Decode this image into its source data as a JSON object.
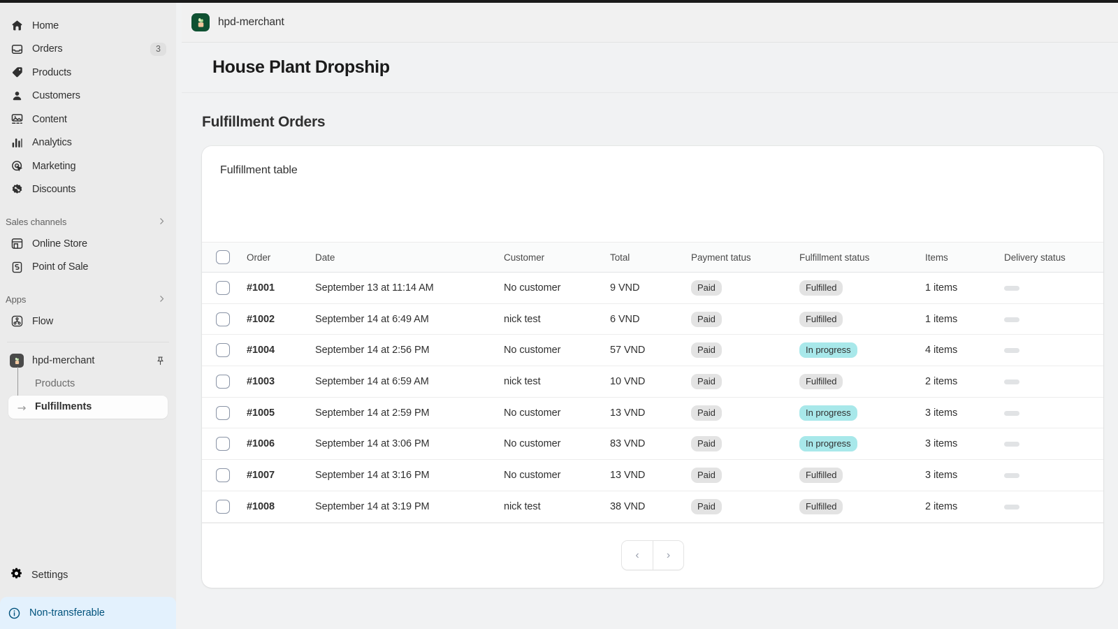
{
  "sidebar": {
    "nav": [
      {
        "label": "Home",
        "icon": "home-icon"
      },
      {
        "label": "Orders",
        "icon": "orders-icon",
        "count": "3"
      },
      {
        "label": "Products",
        "icon": "products-tag-icon"
      },
      {
        "label": "Customers",
        "icon": "customers-person-icon"
      },
      {
        "label": "Content",
        "icon": "content-image-icon"
      },
      {
        "label": "Analytics",
        "icon": "analytics-bars-icon"
      },
      {
        "label": "Marketing",
        "icon": "marketing-target-icon"
      },
      {
        "label": "Discounts",
        "icon": "discounts-badge-icon"
      }
    ],
    "sales_channels": {
      "label": "Sales channels",
      "chevron": "chevron-right-icon"
    },
    "channels": [
      {
        "label": "Online Store",
        "icon": "storefront-icon"
      },
      {
        "label": "Point of Sale",
        "icon": "point-of-sale-icon"
      }
    ],
    "apps_section": {
      "label": "Apps",
      "chevron": "chevron-right-icon"
    },
    "apps": [
      {
        "label": "Flow",
        "icon": "flow-icon"
      }
    ],
    "installed_app": {
      "label": "hpd-merchant",
      "icon": "app-plant-icon",
      "pin_icon": "pin-icon",
      "children": [
        {
          "label": "Products",
          "active": false
        },
        {
          "label": "Fulfillments",
          "active": true
        }
      ]
    },
    "settings": {
      "label": "Settings",
      "icon": "gear-icon"
    },
    "transfer_banner": {
      "label": "Non-transferable",
      "icon": "info-circle-icon"
    }
  },
  "app_header": {
    "icon": "app-plant-icon",
    "title": "hpd-merchant"
  },
  "page": {
    "title": "House Plant Dropship",
    "section_title": "Fulfillment Orders"
  },
  "card": {
    "title": "Fulfillment table",
    "select_all_checkbox": "select-all",
    "columns": [
      "Order",
      "Date",
      "Customer",
      "Total",
      "Payment tatus",
      "Fulfillment status",
      "Items",
      "Delivery status"
    ],
    "rows": [
      {
        "order": "#1001",
        "date": "September 13 at 11:14 AM",
        "customer": "No customer",
        "total": "9 VND",
        "payment": "Paid",
        "fulfillment": "Fulfilled",
        "fulfillment_tone": "grey",
        "items": "1 items",
        "delivery": ""
      },
      {
        "order": "#1002",
        "date": "September 14 at 6:49 AM",
        "customer": "nick test",
        "total": "6 VND",
        "payment": "Paid",
        "fulfillment": "Fulfilled",
        "fulfillment_tone": "grey",
        "items": "1 items",
        "delivery": ""
      },
      {
        "order": "#1004",
        "date": "September 14 at 2:56 PM",
        "customer": "No customer",
        "total": "57 VND",
        "payment": "Paid",
        "fulfillment": "In progress",
        "fulfillment_tone": "teal",
        "items": "4 items",
        "delivery": ""
      },
      {
        "order": "#1003",
        "date": "September 14 at 6:59 AM",
        "customer": "nick test",
        "total": "10 VND",
        "payment": "Paid",
        "fulfillment": "Fulfilled",
        "fulfillment_tone": "grey",
        "items": "2 items",
        "delivery": ""
      },
      {
        "order": "#1005",
        "date": "September 14 at 2:59 PM",
        "customer": "No customer",
        "total": "13 VND",
        "payment": "Paid",
        "fulfillment": "In progress",
        "fulfillment_tone": "teal",
        "items": "3 items",
        "delivery": ""
      },
      {
        "order": "#1006",
        "date": "September 14 at 3:06 PM",
        "customer": "No customer",
        "total": "83 VND",
        "payment": "Paid",
        "fulfillment": "In progress",
        "fulfillment_tone": "teal",
        "items": "3 items",
        "delivery": ""
      },
      {
        "order": "#1007",
        "date": "September 14 at 3:16 PM",
        "customer": "No customer",
        "total": "13 VND",
        "payment": "Paid",
        "fulfillment": "Fulfilled",
        "fulfillment_tone": "grey",
        "items": "3 items",
        "delivery": ""
      },
      {
        "order": "#1008",
        "date": "September 14 at 3:19 PM",
        "customer": "nick test",
        "total": "38 VND",
        "payment": "Paid",
        "fulfillment": "Fulfilled",
        "fulfillment_tone": "grey",
        "items": "2 items",
        "delivery": ""
      }
    ],
    "pagination": {
      "prev_label": "‹",
      "next_label": "›"
    }
  },
  "colors": {
    "sidebar_bg": "#ebebeb",
    "content_bg": "#f1f2f3",
    "card_bg": "#ffffff",
    "app_icon_green": "#0f5132",
    "badge_grey": "#e3e3e3",
    "badge_teal": "#a8e8ea",
    "banner_bg": "#e3f1fd",
    "banner_text": "#00527c",
    "text_primary": "#303030",
    "text_muted": "#6b6b6b"
  }
}
